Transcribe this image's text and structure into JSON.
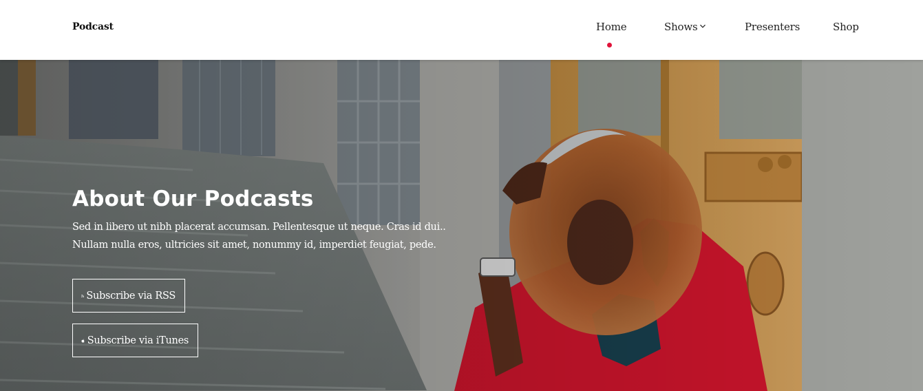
{
  "brand": "Podcast",
  "nav": {
    "items": [
      {
        "label": "Home",
        "active": true
      },
      {
        "label": "Shows",
        "has_dropdown": true
      },
      {
        "label": "Presenters"
      },
      {
        "label": "Shop"
      }
    ]
  },
  "hero": {
    "title": "About Our Podcasts",
    "text": "Sed in libero ut nibh placerat accumsan. Pellentesque ut neque. Cras id dui.. Nullam nulla eros, ultricies sit amet, nonummy id, imperdiet feugiat, pede.",
    "buttons": [
      {
        "label": "Subscribe via RSS",
        "icon": "rss-icon"
      },
      {
        "label": "Subscribe via iTunes",
        "icon": "apple-icon"
      }
    ]
  },
  "colors": {
    "accent": "#e0133a",
    "jacket": "#c8142b",
    "background": "#ffffff"
  }
}
